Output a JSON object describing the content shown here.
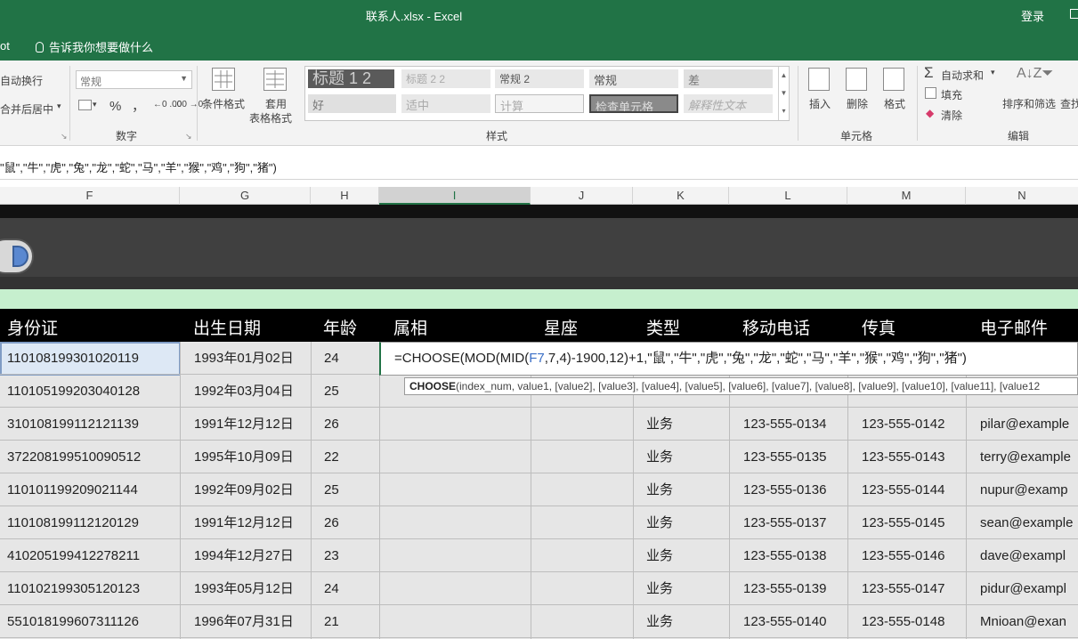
{
  "titlebar": {
    "title": "联系人.xlsx  -  Excel",
    "login": "登录"
  },
  "tabs": {
    "partial": "ot",
    "tell_me": "告诉我你想要做什么"
  },
  "ribbon": {
    "alignment": {
      "wrap": "自动换行",
      "merge": "合并后居中"
    },
    "number": {
      "format": "常规",
      "percent": "%",
      "comma": "，",
      "dec_inc": "←0 .00",
      "dec_dec": ".00 →0",
      "group": "数字"
    },
    "styles": {
      "conditional": "条件格式",
      "table_format_1": "套用",
      "table_format_2": "表格格式",
      "cells": [
        "标题 1 2",
        "标题 2 2",
        "常规 2",
        "常规",
        "差",
        "好",
        "适中",
        "计算",
        "检查单元格",
        "解释性文本"
      ],
      "group": "样式"
    },
    "cells": {
      "insert": "插入",
      "delete": "删除",
      "format": "格式",
      "group": "单元格"
    },
    "editing": {
      "autosum": "自动求和",
      "fill": "填充",
      "clear": "清除",
      "sort": "排序和筛选",
      "find": "查找",
      "group": "编辑"
    }
  },
  "formula_bar": {
    "text": "\"鼠\",\"牛\",\"虎\",\"兔\",\"龙\",\"蛇\",\"马\",\"羊\",\"猴\",\"鸡\",\"狗\",\"猪\")"
  },
  "columns": [
    "F",
    "G",
    "H",
    "I",
    "J",
    "K",
    "L",
    "M",
    "N"
  ],
  "table": {
    "headers": [
      "身份证",
      "出生日期",
      "年龄",
      "属相",
      "星座",
      "类型",
      "移动电话",
      "传真",
      "电子邮件"
    ],
    "rows": [
      [
        "110108199301020119",
        "1993年01月02日",
        "24",
        "",
        "",
        "",
        "",
        "",
        ""
      ],
      [
        "110105199203040128",
        "1992年03月04日",
        "25",
        "",
        "",
        "",
        "",
        "",
        ""
      ],
      [
        "310108199112121139",
        "1991年12月12日",
        "26",
        "",
        "",
        "业务",
        "123-555-0134",
        "123-555-0142",
        "pilar@example"
      ],
      [
        "372208199510090512",
        "1995年10月09日",
        "22",
        "",
        "",
        "业务",
        "123-555-0135",
        "123-555-0143",
        "terry@example"
      ],
      [
        "110101199209021144",
        "1992年09月02日",
        "25",
        "",
        "",
        "业务",
        "123-555-0136",
        "123-555-0144",
        "nupur@examp"
      ],
      [
        "110108199112120129",
        "1991年12月12日",
        "26",
        "",
        "",
        "业务",
        "123-555-0137",
        "123-555-0145",
        "sean@example"
      ],
      [
        "410205199412278211",
        "1994年12月27日",
        "23",
        "",
        "",
        "业务",
        "123-555-0138",
        "123-555-0146",
        "dave@exampl"
      ],
      [
        "110102199305120123",
        "1993年05月12日",
        "24",
        "",
        "",
        "业务",
        "123-555-0139",
        "123-555-0147",
        "pidur@exampl"
      ],
      [
        "551018199607311126",
        "1996年07月31日",
        "21",
        "",
        "",
        "业务",
        "123-555-0140",
        "123-555-0148",
        "Mnioan@exan"
      ]
    ]
  },
  "edit": {
    "prefix": "=CHOOSE(MOD(MID(",
    "ref": "F7",
    "mid": ",7,4)-1900,12)",
    "after": "+1,\"鼠\",\"牛\",\"虎\",\"兔\",\"龙\",\"蛇\",\"马\",\"羊\",\"猴\",\"鸡\",\"狗\",\"猪\")",
    "tooltip_fn": "CHOOSE",
    "tooltip_args": "(index_num, value1, [value2], [value3], [value4], [value5], [value6], [value7], [value8], [value9], [value10], [value11], [value12"
  },
  "colors": {
    "excel_green": "#217346",
    "ref_blue": "#3b6fc6",
    "green_band": "#c6efce",
    "selection": "#dde8f5"
  }
}
